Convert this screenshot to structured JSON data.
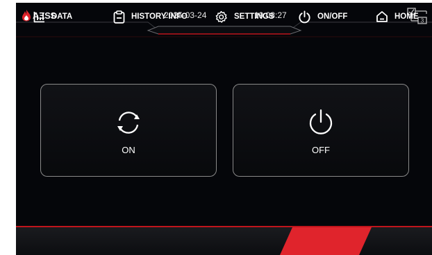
{
  "header": {
    "brand": "AΞSS",
    "date": "2025-03-24",
    "time": "19:08:27",
    "network_badge": "3"
  },
  "main": {
    "on_label": "ON",
    "off_label": "OFF"
  },
  "nav": {
    "data_label": "DATA",
    "history_label": "HISTORY INFO",
    "settings_label": "SETTINGS",
    "onoff_label": "ON/OFF",
    "home_label": "HOME",
    "active": "ON/OFF"
  },
  "colors": {
    "accent_red": "#e0242c",
    "background": "#05060a",
    "button_border": "#8a8a8a"
  },
  "icons": [
    "flame-logo-icon",
    "network-status-icon",
    "refresh-cycle-icon",
    "power-icon",
    "bar-chart-icon",
    "clipboard-icon",
    "gear-icon",
    "home-icon"
  ]
}
